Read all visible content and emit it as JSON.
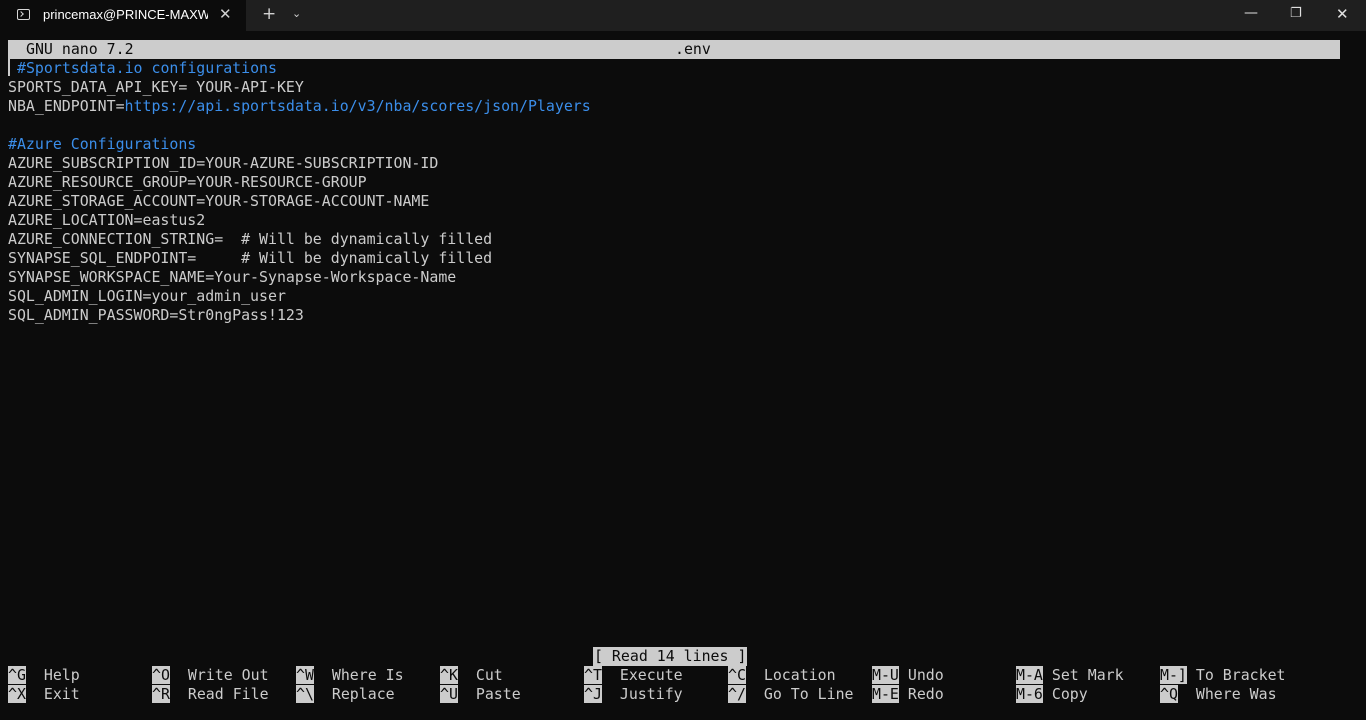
{
  "window": {
    "tab_title": "princemax@PRINCE-MAXWELL",
    "tab_close_glyph": "✕",
    "new_tab_glyph": "+",
    "dropdown_glyph": "⌄",
    "minimize_glyph": "—",
    "maximize_glyph": "❐",
    "close_glyph": "✕"
  },
  "nano": {
    "version": "GNU nano 7.2",
    "filename": ".env",
    "status": "[ Read 14 lines ]"
  },
  "lines": [
    {
      "prefix": "",
      "text": "#Sportsdata.io configurations",
      "kind": "comment"
    },
    {
      "prefix": "",
      "text": "SPORTS_DATA_API_KEY= YOUR-API-KEY",
      "kind": "plain"
    },
    {
      "prefix": "NBA_ENDPOINT=",
      "text": "https://api.sportsdata.io/v3/nba/scores/json/Players",
      "kind": "url"
    },
    {
      "prefix": "",
      "text": "",
      "kind": "plain"
    },
    {
      "prefix": "",
      "text": "#Azure Configurations",
      "kind": "comment"
    },
    {
      "prefix": "",
      "text": "AZURE_SUBSCRIPTION_ID=YOUR-AZURE-SUBSCRIPTION-ID",
      "kind": "plain"
    },
    {
      "prefix": "",
      "text": "AZURE_RESOURCE_GROUP=YOUR-RESOURCE-GROUP",
      "kind": "plain"
    },
    {
      "prefix": "",
      "text": "AZURE_STORAGE_ACCOUNT=YOUR-STORAGE-ACCOUNT-NAME",
      "kind": "plain"
    },
    {
      "prefix": "",
      "text": "AZURE_LOCATION=eastus2",
      "kind": "plain"
    },
    {
      "prefix": "",
      "text": "AZURE_CONNECTION_STRING=  # Will be dynamically filled",
      "kind": "plain"
    },
    {
      "prefix": "",
      "text": "SYNAPSE_SQL_ENDPOINT=     # Will be dynamically filled",
      "kind": "plain"
    },
    {
      "prefix": "",
      "text": "SYNAPSE_WORKSPACE_NAME=Your-Synapse-Workspace-Name",
      "kind": "plain"
    },
    {
      "prefix": "",
      "text": "SQL_ADMIN_LOGIN=your_admin_user",
      "kind": "plain"
    },
    {
      "prefix": "",
      "text": "SQL_ADMIN_PASSWORD=Str0ngPass!123",
      "kind": "plain"
    }
  ],
  "shortcuts": [
    [
      {
        "key": "^G",
        "label": "Help"
      },
      {
        "key": "^O",
        "label": "Write Out"
      },
      {
        "key": "^W",
        "label": "Where Is"
      },
      {
        "key": "^K",
        "label": "Cut"
      },
      {
        "key": "^T",
        "label": "Execute"
      },
      {
        "key": "^C",
        "label": "Location"
      },
      {
        "key": "M-U",
        "label": "Undo"
      },
      {
        "key": "M-A",
        "label": "Set Mark"
      },
      {
        "key": "M-]",
        "label": "To Bracket"
      }
    ],
    [
      {
        "key": "^X",
        "label": "Exit"
      },
      {
        "key": "^R",
        "label": "Read File"
      },
      {
        "key": "^\\",
        "label": "Replace"
      },
      {
        "key": "^U",
        "label": "Paste"
      },
      {
        "key": "^J",
        "label": "Justify"
      },
      {
        "key": "^/",
        "label": "Go To Line"
      },
      {
        "key": "M-E",
        "label": "Redo"
      },
      {
        "key": "M-6",
        "label": "Copy"
      },
      {
        "key": "^Q",
        "label": "Where Was"
      }
    ]
  ],
  "colors": {
    "background": "#0c0c0c",
    "foreground": "#cccccc",
    "highlight": "#3b8eea",
    "titlebar": "#1f1f1f"
  }
}
